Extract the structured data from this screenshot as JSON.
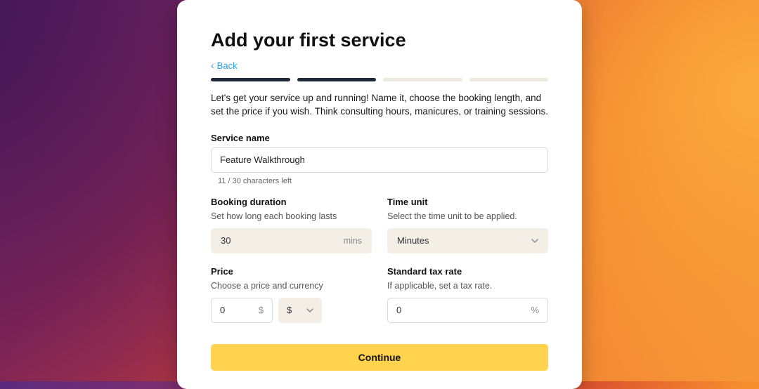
{
  "title": "Add your first service",
  "back_label": "Back",
  "progress": {
    "total_steps": 4,
    "current_step": 2
  },
  "intro": "Let's get your service up and running! Name it, choose the booking length, and set the price if you wish. Think consulting hours, manicures, or training sessions.",
  "service_name": {
    "label": "Service name",
    "value": "Feature Walkthrough",
    "char_counter": "11 / 30 characters left"
  },
  "booking_duration": {
    "label": "Booking duration",
    "sub": "Set how long each booking lasts",
    "value": "30",
    "suffix": "mins"
  },
  "time_unit": {
    "label": "Time unit",
    "sub": "Select the time unit to be applied.",
    "value": "Minutes"
  },
  "price": {
    "label": "Price",
    "sub": "Choose a price and currency",
    "value": "0",
    "currency_symbol_suffix": "$",
    "currency_selected": "$"
  },
  "tax": {
    "label": "Standard tax rate",
    "sub": "If applicable, set a tax rate.",
    "value": "0",
    "suffix": "%"
  },
  "continue_label": "Continue"
}
